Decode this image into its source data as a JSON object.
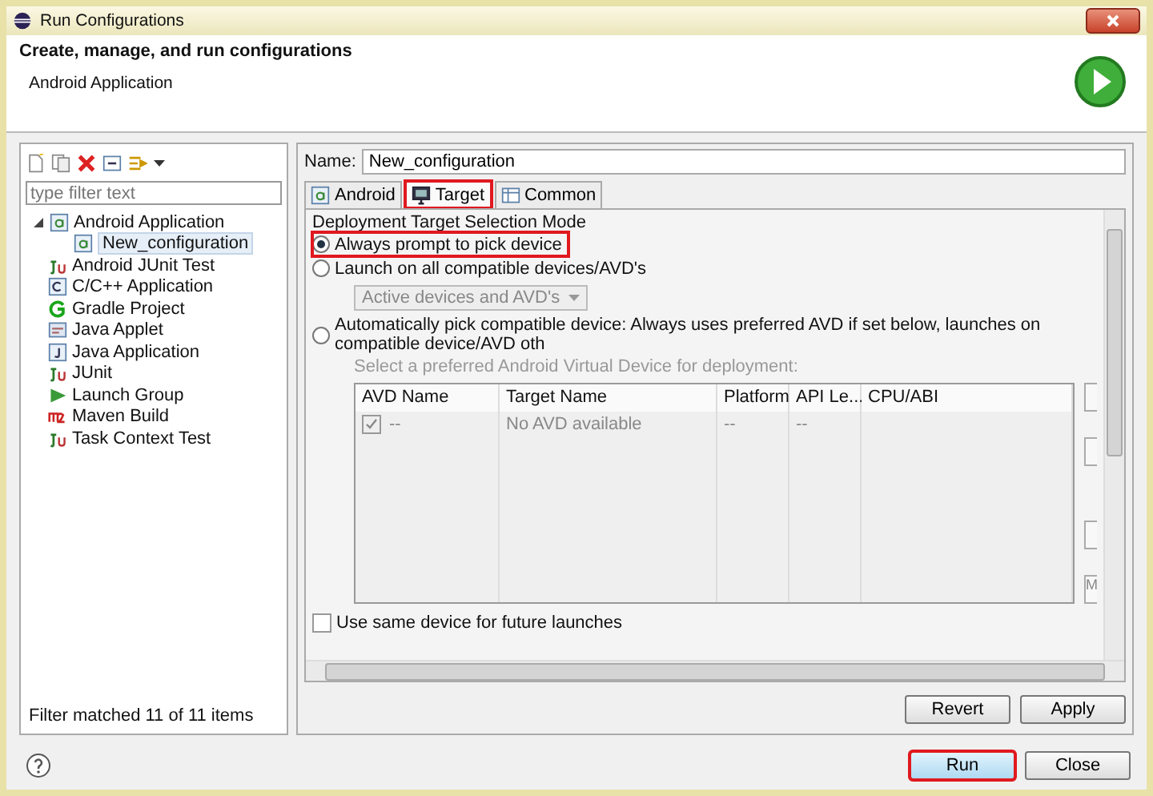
{
  "window": {
    "title": "Run Configurations"
  },
  "header": {
    "title": "Create, manage, and run configurations",
    "subtitle": "Android Application"
  },
  "sidebar": {
    "filter": {
      "placeholder": "type filter text"
    },
    "tree": [
      {
        "label": "Android Application",
        "expanded": true,
        "selected": false,
        "children": [
          {
            "label": "New_configuration",
            "selected": true
          }
        ]
      },
      {
        "label": "Android JUnit Test",
        "selected": false
      },
      {
        "label": "C/C++ Application",
        "selected": false
      },
      {
        "label": "Gradle Project",
        "selected": false
      },
      {
        "label": "Java Applet",
        "selected": false
      },
      {
        "label": "Java Application",
        "selected": false
      },
      {
        "label": "JUnit",
        "selected": false
      },
      {
        "label": "Launch Group",
        "selected": false
      },
      {
        "label": "Maven Build",
        "selected": false
      },
      {
        "label": "Task Context Test",
        "selected": false
      }
    ],
    "status": "Filter matched 11 of 11 items"
  },
  "name_field": {
    "label": "Name:",
    "value": "New_configuration"
  },
  "tabs": [
    {
      "label": "Android",
      "selected": false,
      "highlighted": false
    },
    {
      "label": "Target",
      "selected": true,
      "highlighted": true
    },
    {
      "label": "Common",
      "selected": false,
      "highlighted": false
    }
  ],
  "target": {
    "group_label": "Deployment Target Selection Mode",
    "options": [
      {
        "label": "Always prompt to pick device",
        "selected": true,
        "highlighted": true
      },
      {
        "label": "Launch on all compatible devices/AVD's",
        "selected": false,
        "highlighted": false
      },
      {
        "label": "Automatically pick compatible device: Always uses preferred AVD if set below, launches on compatible device/AVD oth",
        "selected": false,
        "highlighted": false
      }
    ],
    "device_dropdown": {
      "value": "Active devices and AVD's",
      "disabled": true
    },
    "avd_hint": "Select a preferred Android Virtual Device for deployment:",
    "table": {
      "columns": [
        "AVD Name",
        "Target Name",
        "Platform",
        "API Le...",
        "CPU/ABI"
      ],
      "rows": [
        {
          "checked": true,
          "cells": [
            "--",
            "No AVD available",
            "--",
            "--",
            ""
          ]
        }
      ]
    },
    "side_button_label": "M",
    "reuse_device": {
      "label": "Use same device for future launches",
      "checked": false
    }
  },
  "buttons": [
    {
      "label": "Revert",
      "highlighted": false
    },
    {
      "label": "Apply",
      "highlighted": false
    }
  ],
  "footer_buttons": [
    {
      "label": "Run",
      "highlighted": true
    },
    {
      "label": "Close",
      "highlighted": false
    }
  ]
}
